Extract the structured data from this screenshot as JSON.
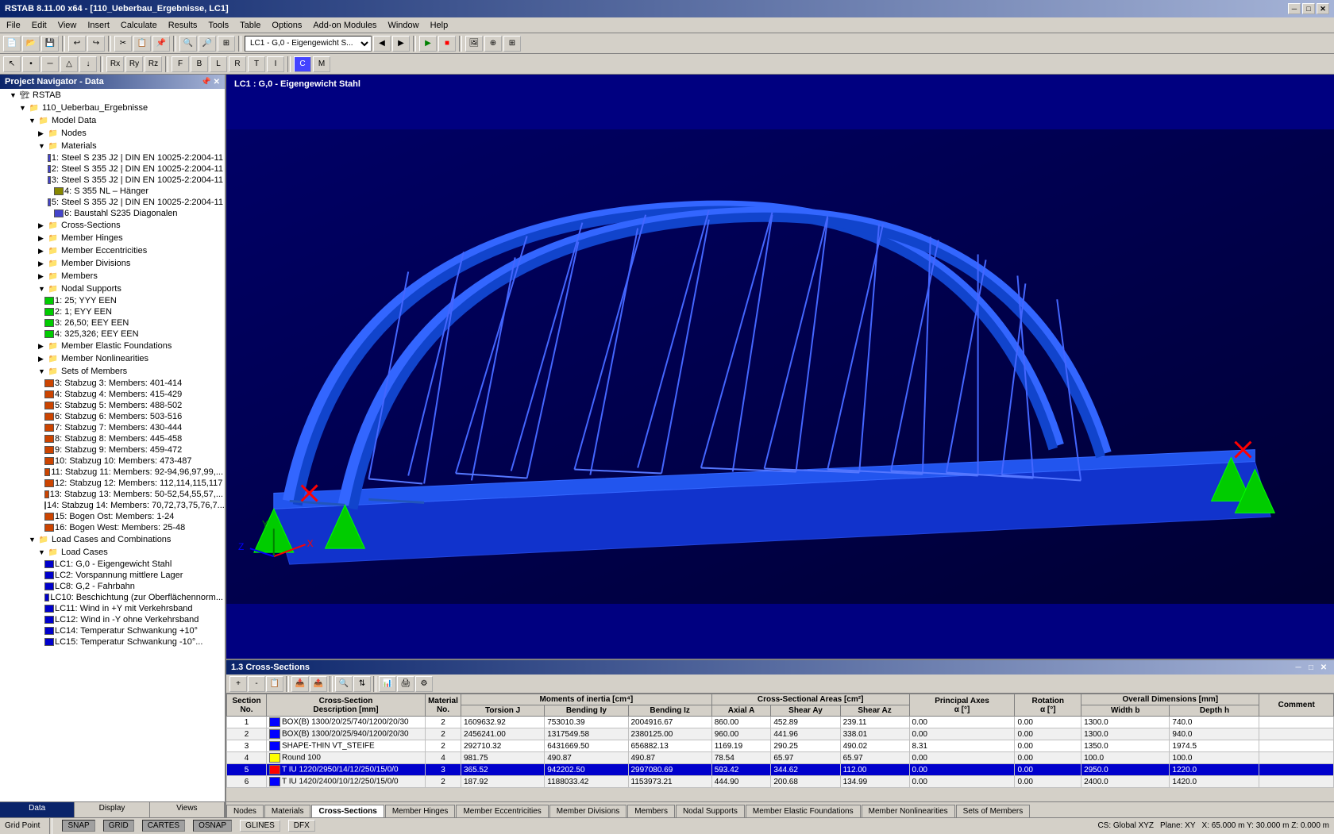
{
  "titleBar": {
    "title": "RSTAB 8.11.00 x64 - [110_Ueberbau_Ergebnisse, LC1]",
    "controls": [
      "minimize",
      "restore",
      "close"
    ]
  },
  "menuBar": {
    "items": [
      "File",
      "Edit",
      "View",
      "Insert",
      "Calculate",
      "Results",
      "Tools",
      "Table",
      "Options",
      "Add-on Modules",
      "Window",
      "Help"
    ]
  },
  "projectNav": {
    "title": "Project Navigator - Data",
    "rootNode": "RSTAB",
    "projectName": "110_Ueberbau_Ergebnisse",
    "tree": [
      {
        "label": "Model Data",
        "indent": 2,
        "type": "folder"
      },
      {
        "label": "Nodes",
        "indent": 3,
        "type": "folder"
      },
      {
        "label": "Materials",
        "indent": 3,
        "type": "folder"
      },
      {
        "label": "1: Steel S 235 J2 | DIN EN 10025-2:2004-11",
        "indent": 4,
        "type": "item"
      },
      {
        "label": "2: Steel S 355 J2 | DIN EN 10025-2:2004-11",
        "indent": 4,
        "type": "item"
      },
      {
        "label": "3: Steel S 355 J2 | DIN EN 10025-2:2004-11",
        "indent": 4,
        "type": "item"
      },
      {
        "label": "4: S 355 NL – Hänger",
        "indent": 4,
        "type": "item"
      },
      {
        "label": "5: Steel S 355 J2 | DIN EN 10025-2:2004-11",
        "indent": 4,
        "type": "item"
      },
      {
        "label": "6: Baustahl S235 Diagonalen",
        "indent": 4,
        "type": "item"
      },
      {
        "label": "Cross-Sections",
        "indent": 3,
        "type": "folder"
      },
      {
        "label": "Member Hinges",
        "indent": 3,
        "type": "folder"
      },
      {
        "label": "Member Eccentricities",
        "indent": 3,
        "type": "folder"
      },
      {
        "label": "Member Divisions",
        "indent": 3,
        "type": "folder"
      },
      {
        "label": "Members",
        "indent": 3,
        "type": "folder"
      },
      {
        "label": "Nodal Supports",
        "indent": 3,
        "type": "folder"
      },
      {
        "label": "1: 25; YYY EEN",
        "indent": 4,
        "type": "item"
      },
      {
        "label": "2: 1; EYY EEN",
        "indent": 4,
        "type": "item"
      },
      {
        "label": "3: 26,50; EEY EEN",
        "indent": 4,
        "type": "item"
      },
      {
        "label": "4: 325,326; EEY EEN",
        "indent": 4,
        "type": "item"
      },
      {
        "label": "Member Elastic Foundations",
        "indent": 3,
        "type": "folder"
      },
      {
        "label": "Member Nonlinearities",
        "indent": 3,
        "type": "folder"
      },
      {
        "label": "Sets of Members",
        "indent": 3,
        "type": "folder"
      },
      {
        "label": "3: Stabzug 3: Members: 401-414",
        "indent": 4,
        "type": "item"
      },
      {
        "label": "4: Stabzug 4: Members: 415-429",
        "indent": 4,
        "type": "item"
      },
      {
        "label": "5: Stabzug 5: Members: 488-502",
        "indent": 4,
        "type": "item"
      },
      {
        "label": "6: Stabzug 6: Members: 503-516",
        "indent": 4,
        "type": "item"
      },
      {
        "label": "7: Stabzug 7: Members: 430-444",
        "indent": 4,
        "type": "item"
      },
      {
        "label": "8: Stabzug 8: Members: 445-458",
        "indent": 4,
        "type": "item"
      },
      {
        "label": "9: Stabzug 9: Members: 459-472",
        "indent": 4,
        "type": "item"
      },
      {
        "label": "10: Stabzug 10: Members: 473-487",
        "indent": 4,
        "type": "item"
      },
      {
        "label": "11: Stabzug 11: Members: 92-94,96,97,99,...",
        "indent": 4,
        "type": "item"
      },
      {
        "label": "12: Stabzug 12: Members: 112,114,115,117",
        "indent": 4,
        "type": "item"
      },
      {
        "label": "13: Stabzug 13: Members: 50-52,54,55,57,...",
        "indent": 4,
        "type": "item"
      },
      {
        "label": "14: Stabzug 14: Members: 70,72,73,75,76,7...",
        "indent": 4,
        "type": "item"
      },
      {
        "label": "15: Bogen Ost: Members: 1-24",
        "indent": 4,
        "type": "item"
      },
      {
        "label": "16: Bogen West: Members: 25-48",
        "indent": 4,
        "type": "item"
      },
      {
        "label": "Load Cases and Combinations",
        "indent": 2,
        "type": "folder"
      },
      {
        "label": "Load Cases",
        "indent": 3,
        "type": "folder"
      },
      {
        "label": "LC1: G,0 - Eigengewicht Stahl",
        "indent": 4,
        "type": "item"
      },
      {
        "label": "LC2: Vorspannung mittlere Lager",
        "indent": 4,
        "type": "item"
      },
      {
        "label": "LC8: G,2 - Fahrbahn",
        "indent": 4,
        "type": "item"
      },
      {
        "label": "LC10: Beschichtung (zur Oberflächennorm...",
        "indent": 4,
        "type": "item"
      },
      {
        "label": "LC11: Wind in +Y mit Verkehrsband",
        "indent": 4,
        "type": "item"
      },
      {
        "label": "LC12: Wind in -Y ohne Verkehrsband",
        "indent": 4,
        "type": "item"
      },
      {
        "label": "LC14: Temperatur Schwankung +10°",
        "indent": 4,
        "type": "item"
      },
      {
        "label": "LC15: Temperatur Schwankung -10°...",
        "indent": 4,
        "type": "item"
      }
    ]
  },
  "viewport": {
    "label": "LC1 : G,0 - Eigengewicht Stahl"
  },
  "bottomPanel": {
    "title": "1.3 Cross-Sections"
  },
  "crossSectionTable": {
    "headers": {
      "col_a": "Section No.",
      "col_b": "Cross-Section Description [mm]",
      "col_c": "Material",
      "col_d_main": "Moments of inertia [cm⁴]",
      "col_d": "Torsion J",
      "col_e": "Bending Iy",
      "col_f": "Bending Iz",
      "col_g_main": "Cross-Sectional Areas [cm²]",
      "col_g": "Axial A",
      "col_h": "Shear Ay",
      "col_i": "Shear Az",
      "col_j_main": "Principal Axes",
      "col_j": "α [°]",
      "col_k_main": "Rotation",
      "col_k": "α [°]",
      "col_l_main": "Overall Dimensions [mm]",
      "col_l": "Width b",
      "col_m": "Depth h",
      "col_n": "Comment"
    },
    "rows": [
      {
        "no": "1",
        "color": "#0000ff",
        "desc": "BOX(B) 1300/20/25/740/1200/20/30",
        "material": "2",
        "torsion": "1609632.92",
        "bending_iy": "753010.39",
        "bending_iz": "2004916.67",
        "axial_a": "860.00",
        "shear_ay": "452.89",
        "shear_az": "239.11",
        "rot_alpha": "0.00",
        "alpha": "0.00",
        "width_b": "1300.0",
        "depth_h": "740.0",
        "comment": ""
      },
      {
        "no": "2",
        "color": "#0000ff",
        "desc": "BOX(B) 1300/20/25/940/1200/20/30",
        "material": "2",
        "torsion": "2456241.00",
        "bending_iy": "1317549.58",
        "bending_iz": "2380125.00",
        "axial_a": "960.00",
        "shear_ay": "441.96",
        "shear_az": "338.01",
        "rot_alpha": "0.00",
        "alpha": "0.00",
        "width_b": "1300.0",
        "depth_h": "940.0",
        "comment": ""
      },
      {
        "no": "3",
        "color": "#0000ff",
        "desc": "SHAPE-THIN VT_STEIFE",
        "material": "2",
        "torsion": "292710.32",
        "bending_iy": "6431669.50",
        "bending_iz": "656882.13",
        "axial_a": "1169.19",
        "shear_ay": "290.25",
        "shear_az": "490.02",
        "rot_alpha": "8.31",
        "alpha": "0.00",
        "width_b": "1350.0",
        "depth_h": "1974.5",
        "comment": ""
      },
      {
        "no": "4",
        "color": "#ffff00",
        "desc": "Round 100",
        "material": "4",
        "torsion": "981.75",
        "bending_iy": "490.87",
        "bending_iz": "490.87",
        "axial_a": "78.54",
        "shear_ay": "65.97",
        "shear_az": "65.97",
        "rot_alpha": "0.00",
        "alpha": "0.00",
        "width_b": "100.0",
        "depth_h": "100.0",
        "comment": ""
      },
      {
        "no": "5",
        "color": "#ff0000",
        "desc": "T IU 1220/2950/14/12/250/15/0/0",
        "material": "3",
        "torsion": "365.52",
        "bending_iy": "942202.50",
        "bending_iz": "2997080.69",
        "axial_a": "593.42",
        "shear_ay": "344.62",
        "shear_az": "112.00",
        "rot_alpha": "0.00",
        "alpha": "0.00",
        "width_b": "2950.0",
        "depth_h": "1220.0",
        "comment": ""
      },
      {
        "no": "6",
        "color": "#0000ff",
        "desc": "T IU 1420/2400/10/12/250/15/0/0",
        "material": "2",
        "torsion": "187.92",
        "bending_iy": "1188033.42",
        "bending_iz": "1153973.21",
        "axial_a": "444.90",
        "shear_ay": "200.68",
        "shear_az": "134.99",
        "rot_alpha": "0.00",
        "alpha": "0.00",
        "width_b": "2400.0",
        "depth_h": "1420.0",
        "comment": ""
      }
    ]
  },
  "csTabs": [
    "Nodes",
    "Materials",
    "Cross-Sections",
    "Member Hinges",
    "Member Eccentricities",
    "Member Divisions",
    "Members",
    "Nodal Supports",
    "Member Elastic Foundations",
    "Member Nonlinearities",
    "Sets of Members"
  ],
  "navBottomTabs": [
    "Data",
    "Display",
    "Views"
  ],
  "statusBar": {
    "label": "Grid Point",
    "buttons": [
      "SNAP",
      "GRID",
      "CARTES",
      "OSNAP",
      "GLINES",
      "DFX"
    ],
    "activeButtons": [
      "SNAP",
      "GRID",
      "CARTES",
      "OSNAP"
    ],
    "coordSystem": "CS: Global XYZ",
    "plane": "Plane: XY",
    "coords": "X: 65.000 m   Y: 30.000 m   Z: 0.000 m"
  }
}
